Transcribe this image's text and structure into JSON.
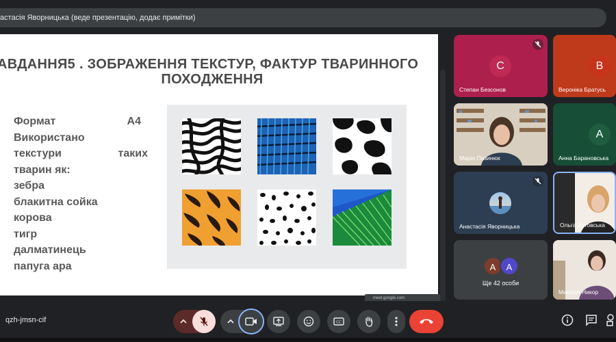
{
  "presenter_banner": "астасія Яворницька (веде презентацію, додає примітки)",
  "slide": {
    "title_line1": "АВДАННЯ5 . ЗОБРАЖЕННЯ ТЕКСТУР, ФАКТУР ТВАРИННОГО",
    "title_line2": "ПОХОДЖЕННЯ",
    "format_label": "Формат",
    "format_value": "А4",
    "used_label": "Використано",
    "textures_label": "текстури",
    "such_label": "таких",
    "animals_intro": "тварин як:",
    "animals": [
      "зебра",
      "блакитна сойка",
      "корова",
      "тигр",
      "далматинець",
      "папуга ара"
    ]
  },
  "url_chip": "meet.google.com",
  "participants": [
    {
      "name": "Степан Безсонов",
      "initial": "С",
      "color": "#bf2a54",
      "bg": "#ad1f4d"
    },
    {
      "name": "Вероніка Братусь",
      "initial": "В",
      "color": "#c8331b",
      "bg": "#bf3a1a"
    },
    {
      "name": "Марія Пазинюк"
    },
    {
      "name": "Анна Барановська",
      "initial": "А",
      "color": "#1e5e3f",
      "bg": "#174e37"
    },
    {
      "name": "Анастасія Яворницька"
    },
    {
      "name": "Ольга Бутовська"
    },
    {
      "name": "Ще 42 особи",
      "initials": [
        "А",
        "А"
      ]
    },
    {
      "name": "Миколія Никор"
    }
  ],
  "meeting_code": "qzh-jmsn-cif",
  "colors": {
    "end_call": "#ea4335",
    "mic_off": "#f9dedc",
    "accent": "#8ab4f8"
  }
}
